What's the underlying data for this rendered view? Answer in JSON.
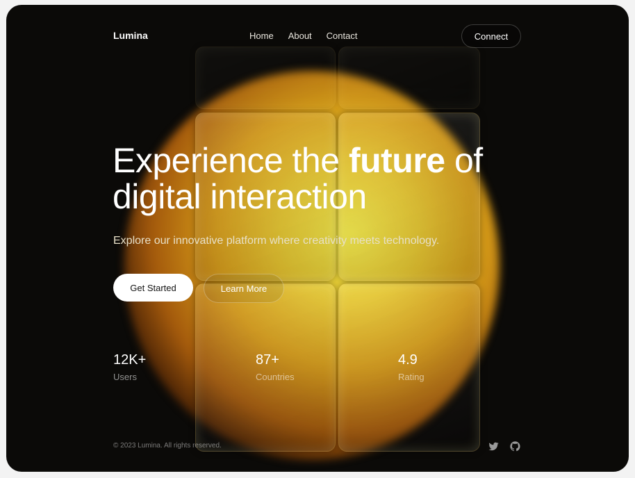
{
  "brand": {
    "name": "Lumina"
  },
  "nav": {
    "items": [
      {
        "label": "Home"
      },
      {
        "label": "About"
      },
      {
        "label": "Contact"
      }
    ]
  },
  "header": {
    "connect_label": "Connect"
  },
  "hero": {
    "headline_part1": "Experience the ",
    "headline_emphasis": "future",
    "headline_part2": " of digital interaction",
    "subtitle": "Explore our innovative platform where creativity meets technology.",
    "primary_cta": "Get Started",
    "secondary_cta": "Learn More"
  },
  "stats": [
    {
      "value": "12K+",
      "label": "Users"
    },
    {
      "value": "87+",
      "label": "Countries"
    },
    {
      "value": "4.9",
      "label": "Rating"
    }
  ],
  "footer": {
    "copyright": "© 2023 Lumina. All rights reserved.",
    "social_icons": [
      "twitter-icon",
      "github-icon"
    ]
  },
  "colors": {
    "background": "#0b0a08",
    "glow": "#e6c630",
    "text": "#ffffff"
  }
}
